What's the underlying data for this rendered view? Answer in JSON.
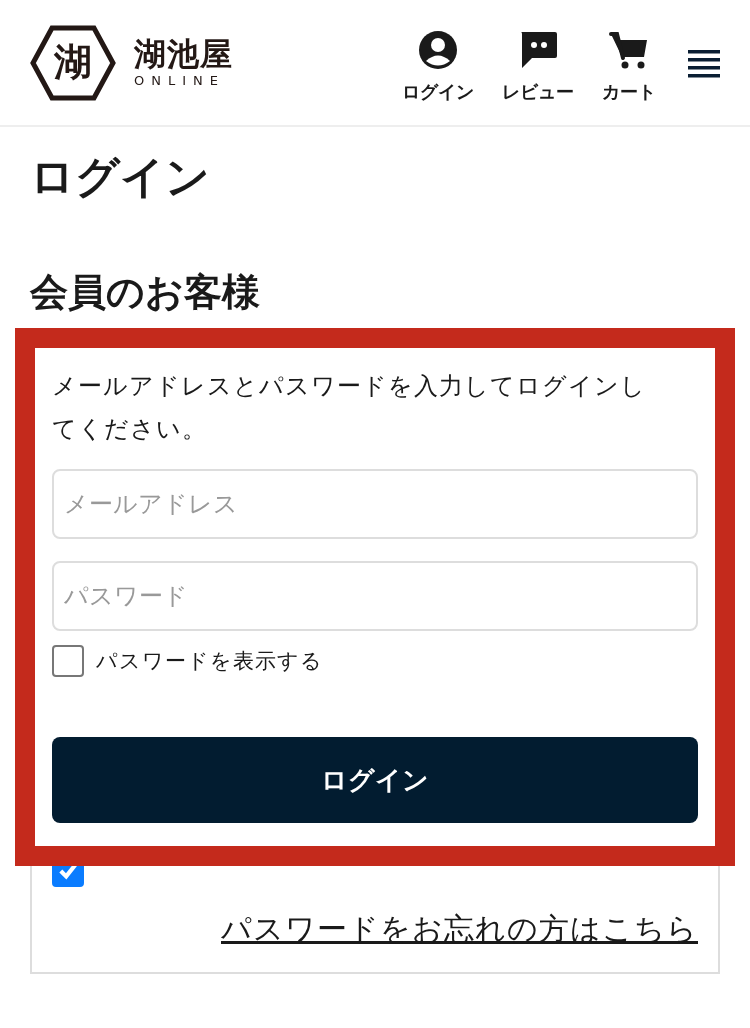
{
  "header": {
    "logo": {
      "mark": "湖",
      "name": "湖池屋",
      "sub": "ONLINE"
    },
    "nav": [
      {
        "kind": "account",
        "label": "ログイン"
      },
      {
        "kind": "review",
        "label": "レビュー"
      },
      {
        "kind": "cart",
        "label": "カート"
      }
    ]
  },
  "page_title": "ログイン",
  "section_heading": "会員のお客様",
  "login_form": {
    "instruction": "メールアドレスとパスワードを入力してログインしてください。",
    "email": {
      "placeholder": "メールアドレス"
    },
    "password": {
      "placeholder": "パスワード"
    },
    "show_password": {
      "label": "パスワードを表示する",
      "checked": false
    },
    "submit": "ログイン",
    "remember": {
      "checked": true
    },
    "forgot_link": "パスワードをお忘れの方はこちら"
  }
}
